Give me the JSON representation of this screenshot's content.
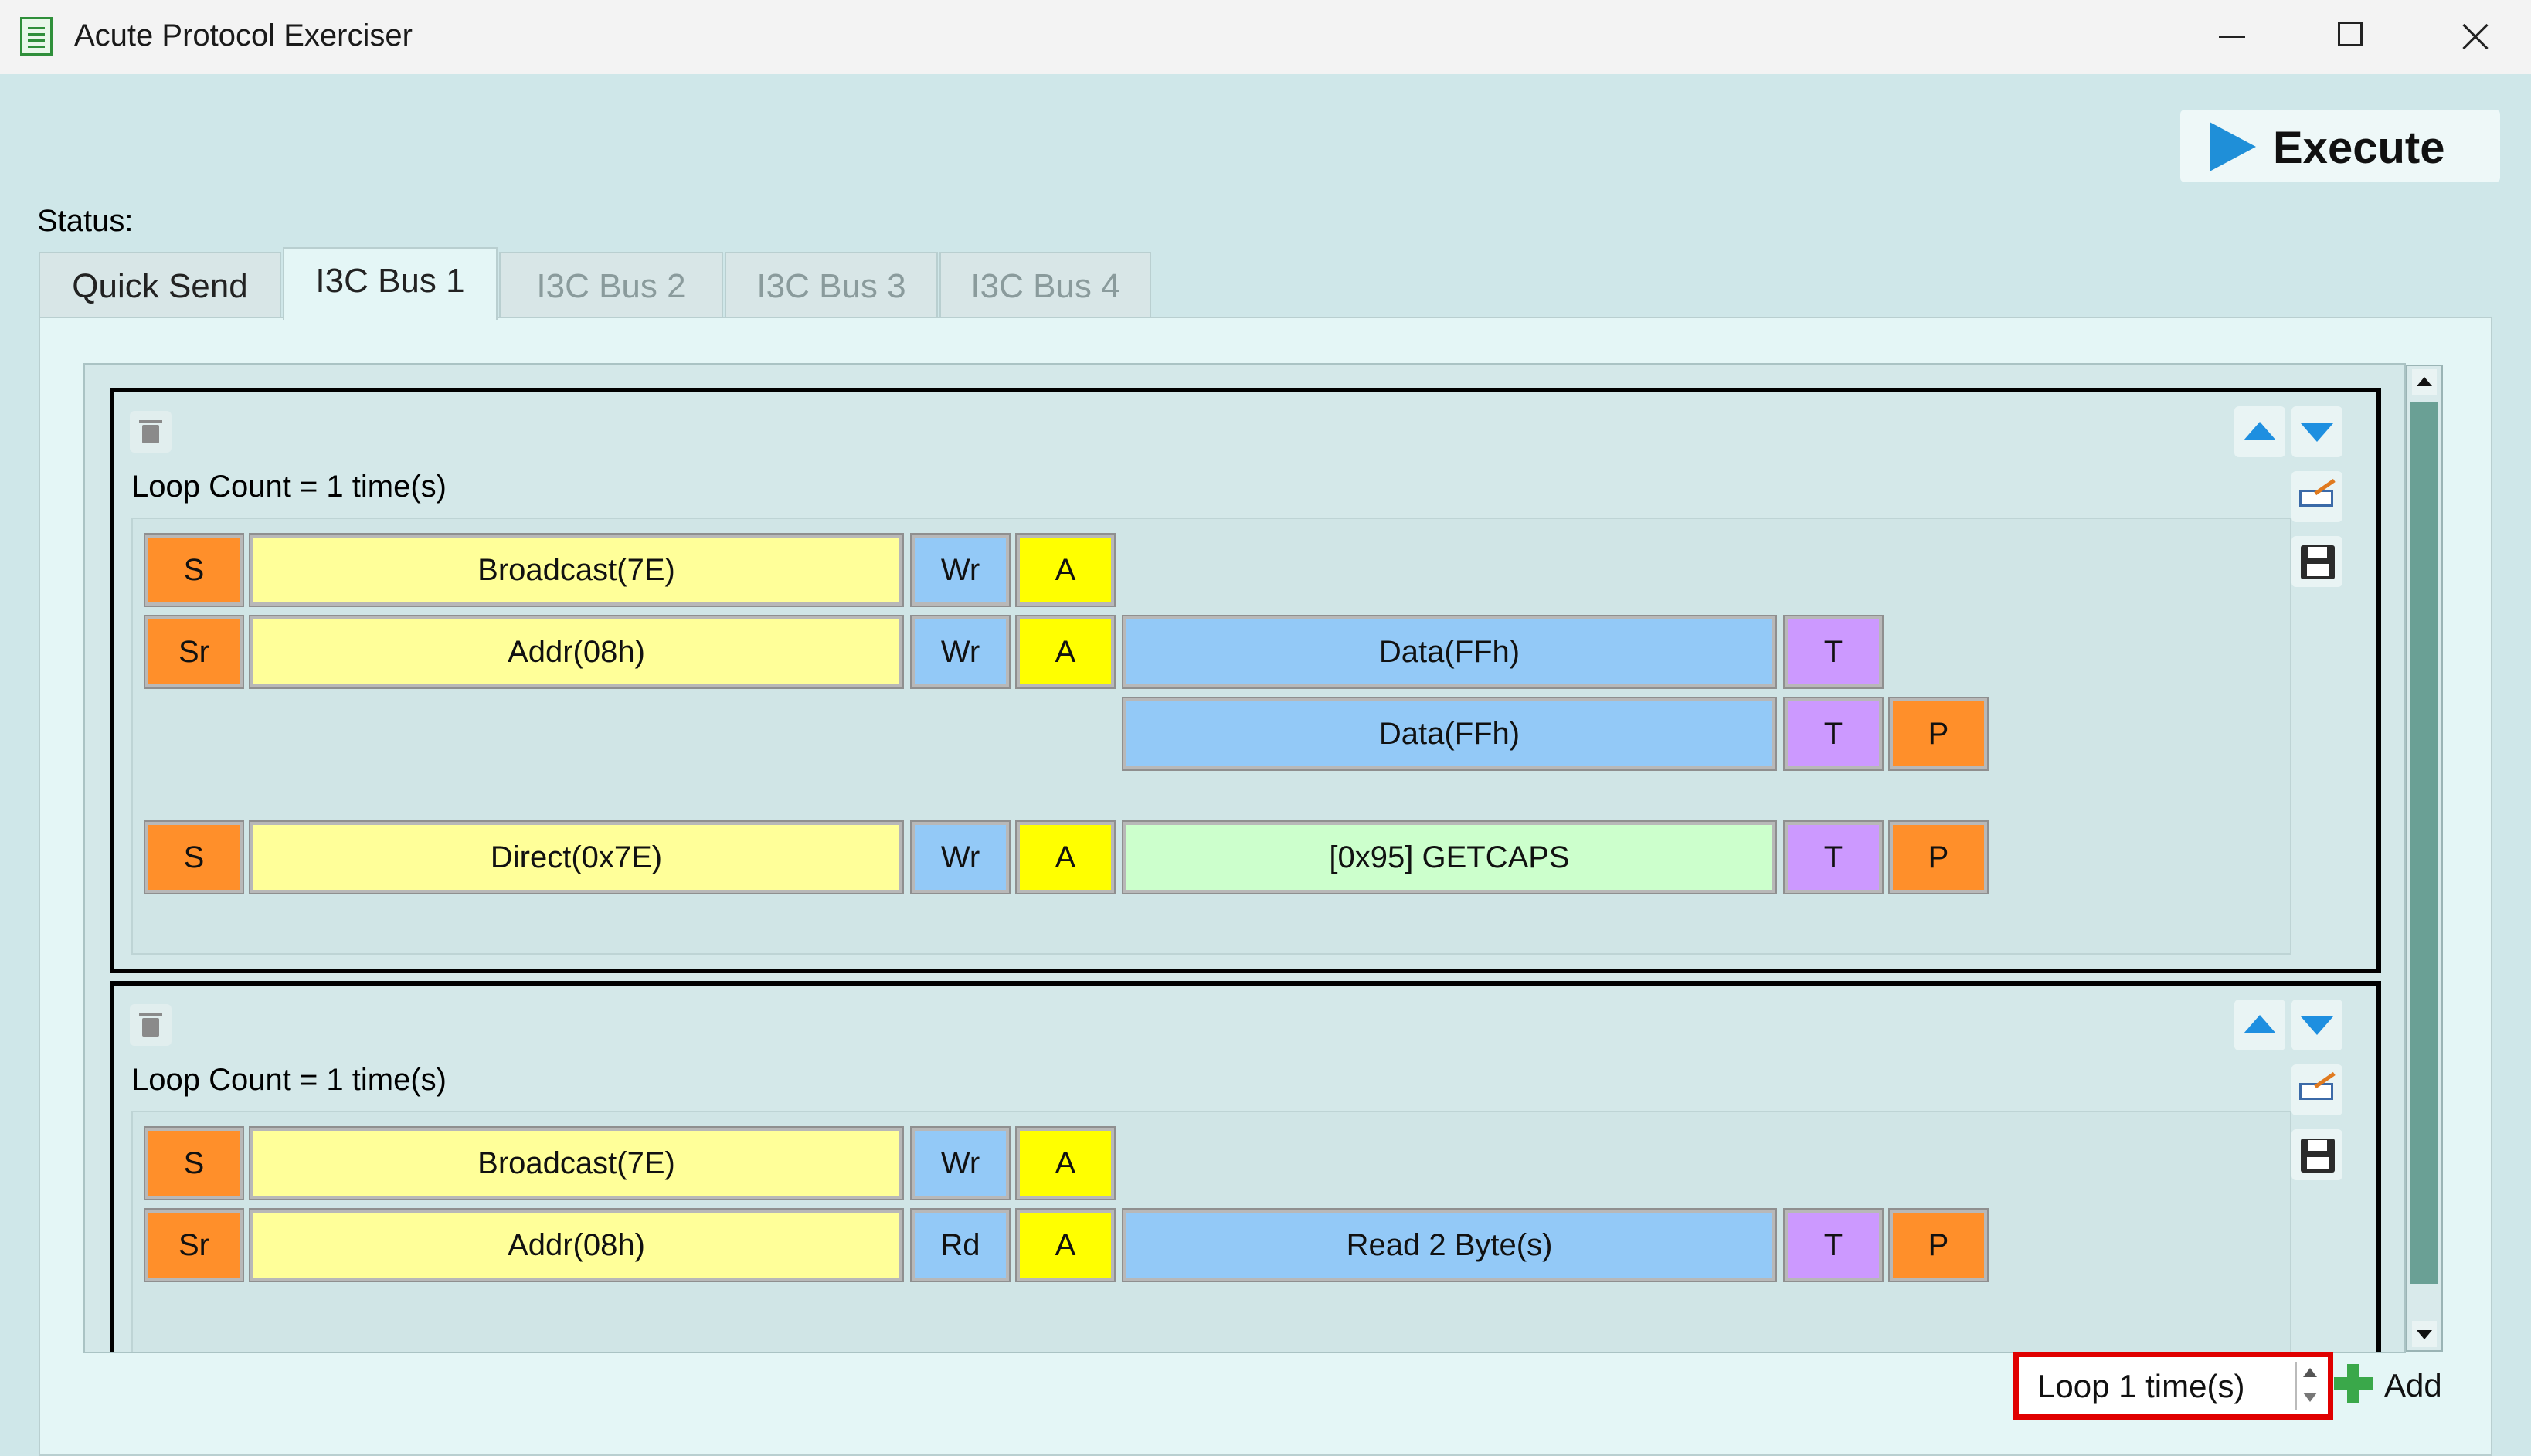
{
  "window": {
    "title": "Acute Protocol Exerciser"
  },
  "toolbar": {
    "execute_label": "Execute"
  },
  "status": {
    "label": "Status:"
  },
  "tabs": [
    {
      "label": "Quick Send",
      "state": "normal"
    },
    {
      "label": "I3C Bus 1",
      "state": "active"
    },
    {
      "label": "I3C Bus 2",
      "state": "disabled"
    },
    {
      "label": "I3C Bus 3",
      "state": "disabled"
    },
    {
      "label": "I3C Bus 4",
      "state": "disabled"
    }
  ],
  "groups": [
    {
      "loop_count_label": "Loop Count = 1 time(s)",
      "rows": [
        {
          "cells": [
            {
              "text": "S",
              "color": "#ff8f2a"
            },
            {
              "text": "Broadcast(7E)",
              "color": "#ffff99"
            },
            {
              "text": "Wr",
              "color": "#93c9f7"
            },
            {
              "text": "A",
              "color": "#ffff00"
            }
          ]
        },
        {
          "cells": [
            {
              "text": "Sr",
              "color": "#ff8f2a"
            },
            {
              "text": "Addr(08h)",
              "color": "#ffff99"
            },
            {
              "text": "Wr",
              "color": "#93c9f7"
            },
            {
              "text": "A",
              "color": "#ffff00"
            },
            {
              "text": "Data(FFh)",
              "color": "#93c9f7"
            },
            {
              "text": "T",
              "color": "#cc99ff"
            }
          ]
        },
        {
          "cells": [
            {
              "text": "Data(FFh)",
              "color": "#93c9f7"
            },
            {
              "text": "T",
              "color": "#cc99ff"
            },
            {
              "text": "P",
              "color": "#ff8f2a"
            }
          ]
        },
        {
          "cells": [
            {
              "text": "S",
              "color": "#ff8f2a"
            },
            {
              "text": "Direct(0x7E)",
              "color": "#ffff99"
            },
            {
              "text": "Wr",
              "color": "#93c9f7"
            },
            {
              "text": "A",
              "color": "#ffff00"
            },
            {
              "text": "[0x95] GETCAPS",
              "color": "#ccffcc"
            },
            {
              "text": "T",
              "color": "#cc99ff"
            },
            {
              "text": "P",
              "color": "#ff8f2a"
            }
          ]
        }
      ]
    },
    {
      "loop_count_label": "Loop Count = 1 time(s)",
      "rows": [
        {
          "cells": [
            {
              "text": "S",
              "color": "#ff8f2a"
            },
            {
              "text": "Broadcast(7E)",
              "color": "#ffff99"
            },
            {
              "text": "Wr",
              "color": "#93c9f7"
            },
            {
              "text": "A",
              "color": "#ffff00"
            }
          ]
        },
        {
          "cells": [
            {
              "text": "Sr",
              "color": "#ff8f2a"
            },
            {
              "text": "Addr(08h)",
              "color": "#ffff99"
            },
            {
              "text": "Rd",
              "color": "#93c9f7"
            },
            {
              "text": "A",
              "color": "#ffff00"
            },
            {
              "text": "Read 2 Byte(s)",
              "color": "#93c9f7"
            },
            {
              "text": "T",
              "color": "#cc99ff"
            },
            {
              "text": "P",
              "color": "#ff8f2a"
            }
          ]
        }
      ]
    }
  ],
  "footer": {
    "loop_value": "Loop 1 time(s)",
    "add_label": "Add"
  }
}
